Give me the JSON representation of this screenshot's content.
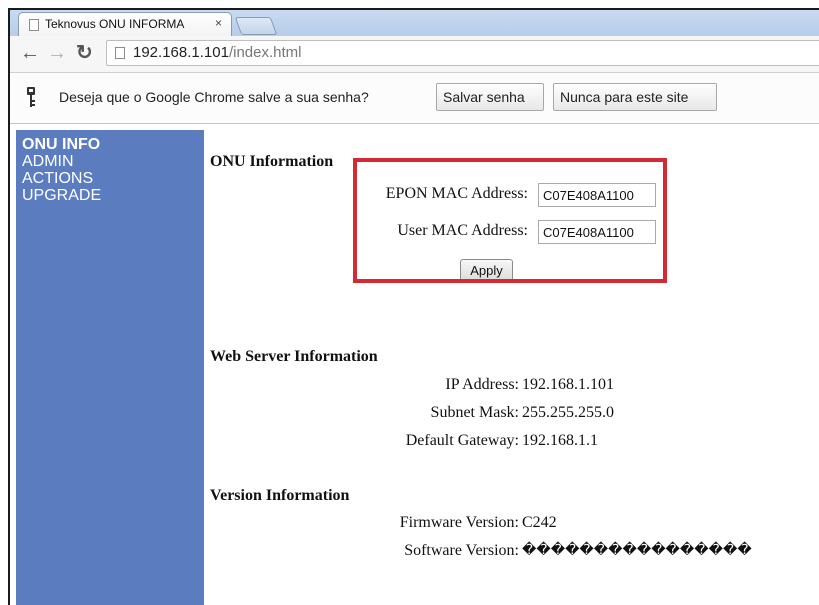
{
  "browser": {
    "tab": {
      "title": "Teknovus ONU INFORMA",
      "close_glyph": "×"
    },
    "address_bar": {
      "host": "192.168.1.101",
      "path": "/index.html"
    },
    "infobar": {
      "message": "Deseja que o Google Chrome salve a sua senha?",
      "save_label": "Salvar senha",
      "never_label": "Nunca para este site"
    }
  },
  "sidebar": {
    "items": [
      {
        "label": "ONU INFO",
        "active": true
      },
      {
        "label": "ADMIN"
      },
      {
        "label": "ACTIONS"
      },
      {
        "label": "UPGRADE"
      }
    ]
  },
  "onu_info": {
    "title": "ONU Information",
    "epon_mac_label": "EPON MAC Address:",
    "epon_mac_value": "C07E408A1100",
    "user_mac_label": "User MAC Address:",
    "user_mac_value": "C07E408A1100",
    "apply_label": "Apply"
  },
  "web_server": {
    "title": "Web Server Information",
    "ip_label": "IP Address:",
    "ip_value": "192.168.1.101",
    "mask_label": "Subnet Mask:",
    "mask_value": "255.255.255.0",
    "gateway_label": "Default Gateway:",
    "gateway_value": "192.168.1.1"
  },
  "version": {
    "title": "Version Information",
    "firmware_label": "Firmware Version:",
    "firmware_value": "C242",
    "software_label": "Software Version:",
    "software_value": "����������������"
  },
  "colors": {
    "sidebar_bg": "#5b7cbf",
    "highlight_border": "#d42a36"
  }
}
